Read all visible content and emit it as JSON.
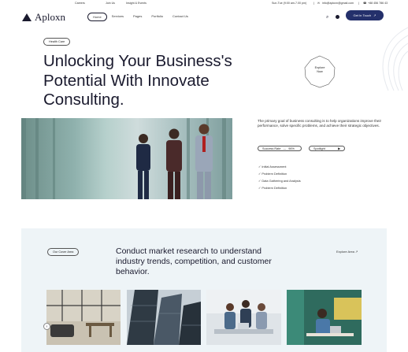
{
  "topbar": {
    "links": [
      "Careers",
      "Join Us",
      "Insight & Events"
    ],
    "hours": "Sun-Tue (9:00 am-7.00 pm)",
    "email": "info@aploxn@gmail.com",
    "phone": "+88 456 786 43"
  },
  "nav": {
    "brand": "Aploxn",
    "items": [
      "Home",
      "Services",
      "Pages",
      "Portfolio",
      "Contact Us"
    ],
    "cta": "Get In Touch",
    "cta_icon": "arrow-up-right"
  },
  "hero": {
    "tag": "Health Care",
    "title_lines": [
      "Unlocking Your Business's",
      "Potential With Innovate",
      "Consulting."
    ],
    "badge_lines": [
      "Explore",
      "Now"
    ],
    "description": "The primary goal of business consulting is to help organizations improve their performance, solve specific problems, and achieve their strategic objectives.",
    "stats": [
      {
        "label": "Success Rate",
        "value": "96%"
      },
      {
        "label": "Spotlight",
        "icon": "play"
      }
    ],
    "bullets": [
      "Initial Assessment",
      "Problem Definition",
      "Data Gathering and Analysis",
      "Problem Definition"
    ]
  },
  "cover": {
    "tag": "Our Cover Area",
    "title": "Conduct market research to understand industry trends, competition, and customer behavior.",
    "explore": "Explore Area"
  },
  "colors": {
    "accent": "#24306b",
    "section_bg": "#eef4f7",
    "text": "#1a1a2e"
  }
}
